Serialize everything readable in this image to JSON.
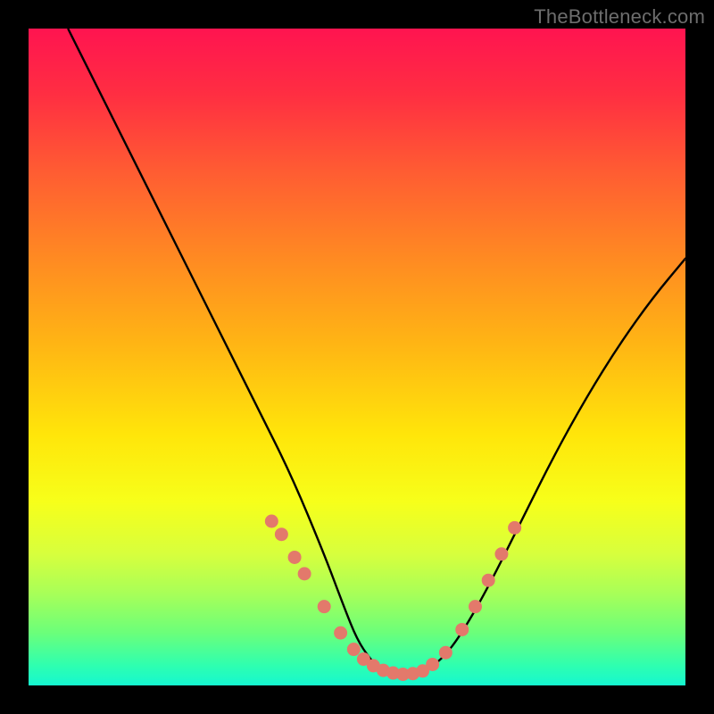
{
  "watermark": "TheBottleneck.com",
  "chart_data": {
    "type": "line",
    "title": "",
    "xlabel": "",
    "ylabel": "",
    "xlim": [
      0,
      100
    ],
    "ylim": [
      0,
      100
    ],
    "series": [
      {
        "name": "curve",
        "style": "solid-black",
        "x": [
          6,
          10,
          15,
          20,
          25,
          30,
          35,
          40,
          45,
          48,
          50,
          52,
          54,
          56,
          58,
          60,
          63,
          66,
          70,
          75,
          80,
          85,
          90,
          95,
          100
        ],
        "y": [
          100,
          92,
          82,
          72,
          62,
          52,
          42,
          32,
          20,
          12,
          7,
          4,
          2,
          1.5,
          1.5,
          2,
          4,
          8,
          15,
          25,
          35,
          44,
          52,
          59,
          65
        ]
      },
      {
        "name": "markers",
        "style": "coral-dots",
        "x": [
          37,
          38.5,
          40.5,
          42,
          45,
          47.5,
          49.5,
          51,
          52.5,
          54,
          55.5,
          57,
          58.5,
          60,
          61.5,
          63.5,
          66,
          68,
          70,
          72,
          74
        ],
        "y": [
          25,
          23,
          19.5,
          17,
          12,
          8,
          5.5,
          4,
          3,
          2.3,
          1.9,
          1.7,
          1.8,
          2.2,
          3.2,
          5,
          8.5,
          12,
          16,
          20,
          24
        ]
      }
    ],
    "colors": {
      "curve": "#000000",
      "markers": "#e3796b",
      "gradient_top": "#ff1450",
      "gradient_bottom": "#15f7d0"
    }
  }
}
